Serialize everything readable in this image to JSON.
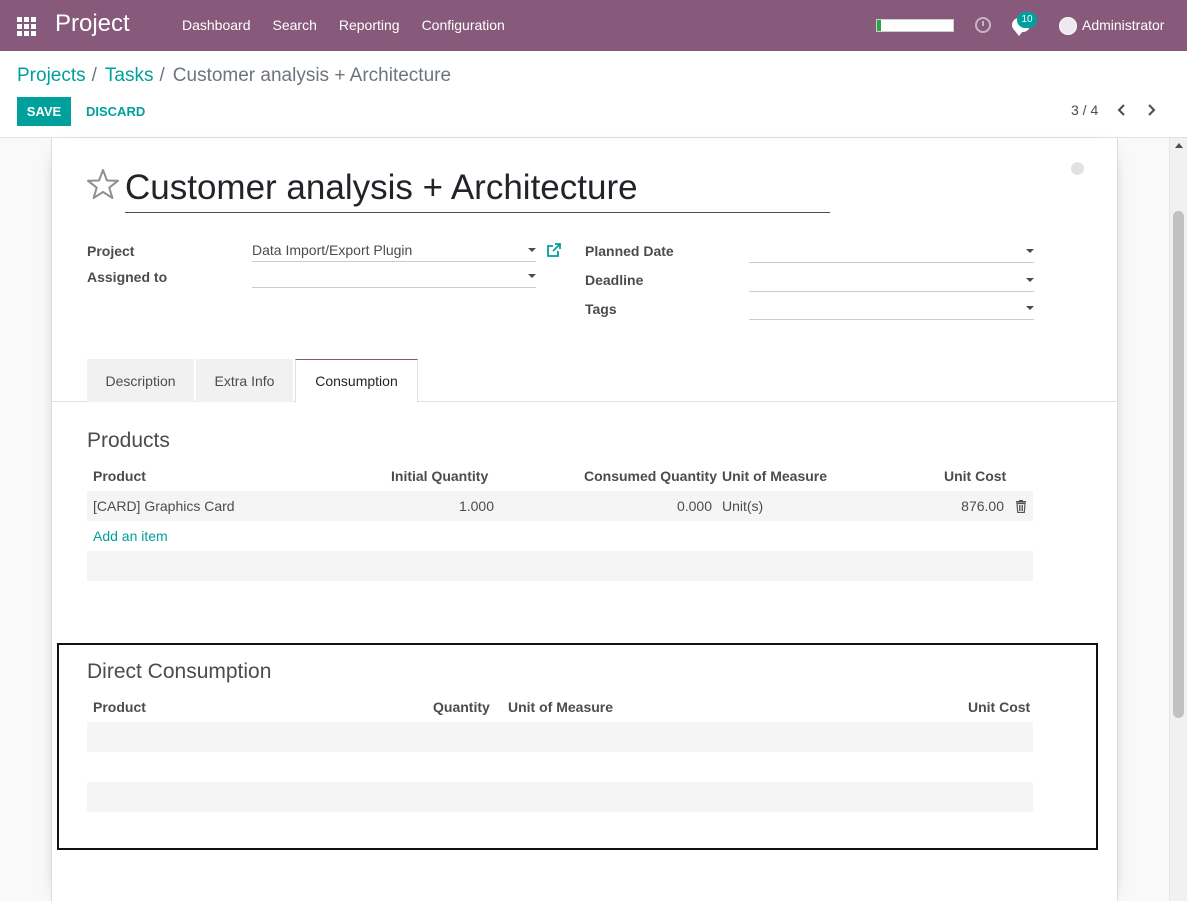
{
  "navbar": {
    "brand": "Project",
    "menu": [
      "Dashboard",
      "Search",
      "Reporting",
      "Configuration"
    ],
    "messages_count": "10",
    "user_name": "Administrator",
    "progress": 0.05
  },
  "breadcrumb": {
    "projects": "Projects",
    "tasks": "Tasks",
    "current": "Customer analysis + Architecture",
    "separator": "/"
  },
  "buttons": {
    "save": "SAVE",
    "discard": "DISCARD"
  },
  "pager": {
    "value": "3 / 4"
  },
  "form": {
    "title": "Customer analysis + Architecture",
    "project_label": "Project",
    "project_value": "Data Import/Export Plugin",
    "assigned_label": "Assigned to",
    "assigned_value": "",
    "planned_date_label": "Planned Date",
    "planned_date_value": "",
    "deadline_label": "Deadline",
    "deadline_value": "",
    "tags_label": "Tags",
    "tags_value": ""
  },
  "tabs": [
    "Description",
    "Extra Info",
    "Consumption"
  ],
  "products": {
    "title": "Products",
    "columns": [
      "Product",
      "Initial Quantity",
      "Consumed Quantity",
      "Unit of Measure",
      "Unit Cost"
    ],
    "rows": [
      {
        "product": "[CARD] Graphics Card",
        "initial_qty": "1.000",
        "consumed_qty": "0.000",
        "uom": "Unit(s)",
        "unit_cost": "876.00"
      }
    ],
    "add_item": "Add an item"
  },
  "direct_consumption": {
    "title": "Direct Consumption",
    "columns": [
      "Product",
      "Quantity",
      "Unit of Measure",
      "Unit Cost"
    ]
  },
  "colors": {
    "navbar": "#875a7b",
    "accent": "#00a09d"
  }
}
